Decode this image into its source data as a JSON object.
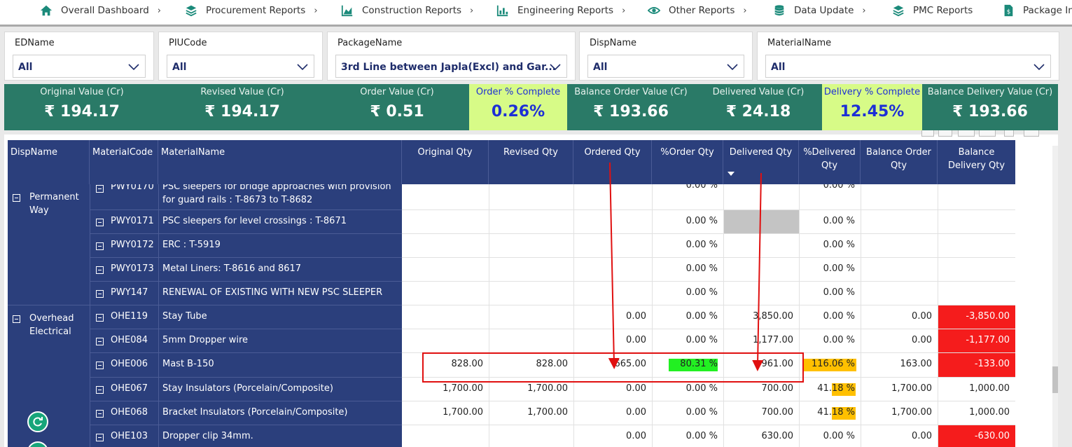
{
  "nav": {
    "items": [
      {
        "label": "Overall Dashboard",
        "icon": "home-icon"
      },
      {
        "label": "Procurement Reports",
        "icon": "layers-icon"
      },
      {
        "label": "Construction Reports",
        "icon": "area-chart-icon"
      },
      {
        "label": "Engineering Reports",
        "icon": "bar-chart-icon"
      },
      {
        "label": "Other Reports",
        "icon": "eye-icon"
      },
      {
        "label": "Data Update",
        "icon": "database-icon"
      },
      {
        "label": "PMC Reports",
        "icon": "layers-icon"
      },
      {
        "label": "Package Inv",
        "icon": "document-dollar-icon"
      }
    ]
  },
  "filters": [
    {
      "label": "EDName",
      "value": "All"
    },
    {
      "label": "PIUCode",
      "value": "All"
    },
    {
      "label": "PackageName",
      "value": "3rd Line between Japla(Excl) and Gar..."
    },
    {
      "label": "DispName",
      "value": "All"
    },
    {
      "label": "MaterialName",
      "value": "All"
    }
  ],
  "kpis": [
    {
      "label": "Original Value (Cr)",
      "value": "₹ 194.17"
    },
    {
      "label": "Revised Value (Cr)",
      "value": "₹ 194.17"
    },
    {
      "label": "Order Value (Cr)",
      "value": "₹ 0.51"
    },
    {
      "label": "Order %  Complete",
      "value": "0.26%"
    },
    {
      "label": "Balance Order Value (Cr)",
      "value": "₹ 193.66"
    },
    {
      "label": "Delivered Value (Cr)",
      "value": "₹ 24.18"
    },
    {
      "label": "Delivery % Complete",
      "value": "12.45%"
    },
    {
      "label": "Balance Delivery Value (Cr)",
      "value": "₹ 193.66"
    }
  ],
  "table": {
    "columns": [
      "DispName",
      "MaterialCode",
      "MaterialName",
      "Original Qty",
      "Revised Qty",
      "Ordered Qty",
      "%Order Qty",
      "Delivered Qty",
      "%Delivered Qty",
      "Balance Order Qty",
      "Balance Delivery Qty"
    ],
    "groups": [
      {
        "name": "Permanent Way"
      },
      {
        "name": "Overhead Electrical"
      }
    ],
    "rows": [
      {
        "code": "PWY0170",
        "name": "PSC sleepers for bridge approaches with provision for guard rails : T-8673 to T-8682",
        "orig": "",
        "rev": "",
        "ord": "",
        "pord": "0.00 %",
        "del": "",
        "pdel": "0.00 %",
        "bord": "",
        "bdel": ""
      },
      {
        "code": "PWY0171",
        "name": "PSC sleepers for level crossings : T-8671",
        "orig": "",
        "rev": "",
        "ord": "",
        "pord": "0.00 %",
        "del": "",
        "pdel": "0.00 %",
        "bord": "",
        "bdel": ""
      },
      {
        "code": "PWY0172",
        "name": "ERC : T-5919",
        "orig": "",
        "rev": "",
        "ord": "",
        "pord": "0.00 %",
        "del": "",
        "pdel": "0.00 %",
        "bord": "",
        "bdel": ""
      },
      {
        "code": "PWY0173",
        "name": "Metal Liners: T-8616 and 8617",
        "orig": "",
        "rev": "",
        "ord": "",
        "pord": "0.00 %",
        "del": "",
        "pdel": "0.00 %",
        "bord": "",
        "bdel": ""
      },
      {
        "code": "PWY147",
        "name": "RENEWAL OF EXISTING WITH NEW PSC SLEEPER",
        "orig": "",
        "rev": "",
        "ord": "",
        "pord": "0.00 %",
        "del": "",
        "pdel": "0.00 %",
        "bord": "",
        "bdel": ""
      },
      {
        "code": "OHE119",
        "name": "Stay Tube",
        "orig": "",
        "rev": "",
        "ord": "0.00",
        "pord": "0.00 %",
        "del": "3,850.00",
        "pdel": "0.00 %",
        "bord": "0.00",
        "bdel": "-3,850.00"
      },
      {
        "code": "OHE084",
        "name": "5mm Dropper wire",
        "orig": "",
        "rev": "",
        "ord": "0.00",
        "pord": "0.00 %",
        "del": "1,177.00",
        "pdel": "0.00 %",
        "bord": "0.00",
        "bdel": "-1,177.00"
      },
      {
        "code": "OHE006",
        "name": "Mast B-150",
        "orig": "828.00",
        "rev": "828.00",
        "ord": "665.00",
        "pord": "80.31 %",
        "del": "961.00",
        "pdel": "116.06 %",
        "bord": "163.00",
        "bdel": "-133.00"
      },
      {
        "code": "OHE067",
        "name": "Stay Insulators (Porcelain/Composite)",
        "orig": "1,700.00",
        "rev": "1,700.00",
        "ord": "0.00",
        "pord": "0.00 %",
        "del": "700.00",
        "pdel": "41.18 %",
        "bord": "1,700.00",
        "bdel": "1,000.00"
      },
      {
        "code": "OHE068",
        "name": "Bracket Insulators (Porcelain/Composite)",
        "orig": "1,700.00",
        "rev": "1,700.00",
        "ord": "0.00",
        "pord": "0.00 %",
        "del": "700.00",
        "pdel": "41.18 %",
        "bord": "1,700.00",
        "bdel": "1,000.00"
      },
      {
        "code": "OHE103",
        "name": "Dropper clip 34mm.",
        "orig": "",
        "rev": "",
        "ord": "0.00",
        "pord": "0.00 %",
        "del": "630.00",
        "pdel": "0.00 %",
        "bord": "0.00",
        "bdel": "-630.00"
      }
    ]
  },
  "colors": {
    "nav_accent": "#1b8a7a",
    "kpi_bg": "#2a7a67",
    "kpi_highlight": "#d7fb87",
    "kpi_highlight_text": "#1d2fd6",
    "header_navy": "#2b3f7c",
    "negative_red": "#f51c1c",
    "order_green": "#22f022",
    "delivered_orange": "#ffc000",
    "annotation_red": "#e01010"
  }
}
